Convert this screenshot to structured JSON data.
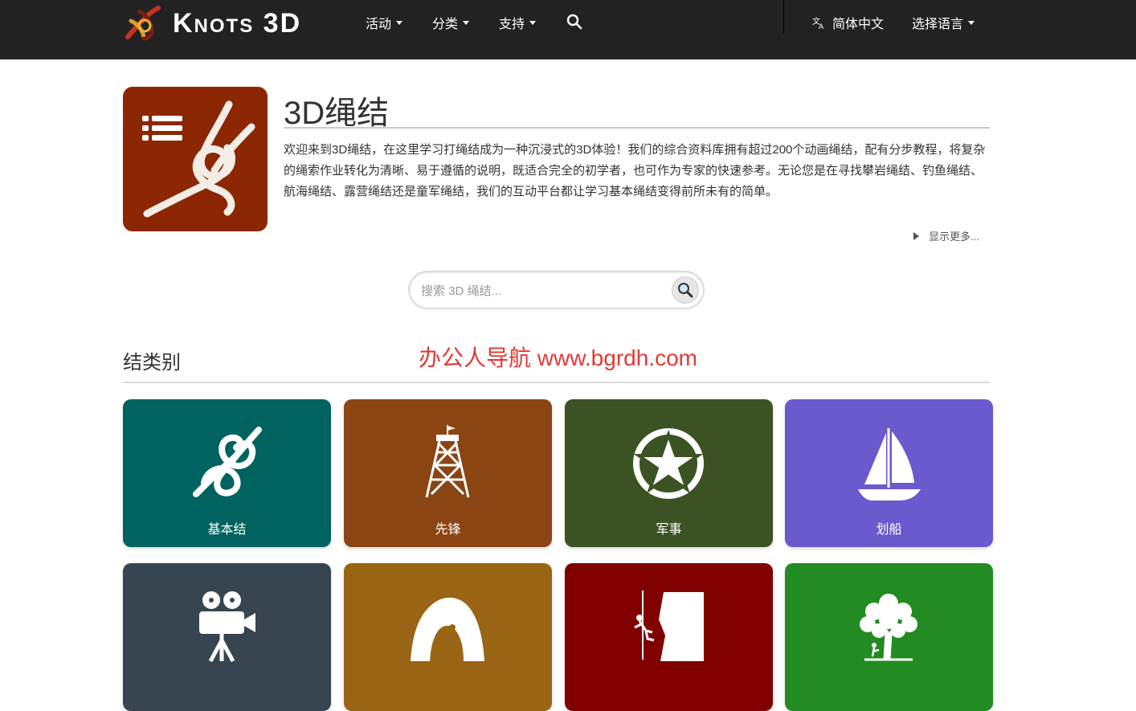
{
  "navbar": {
    "brand": "Knots 3D",
    "menu": [
      {
        "label": "活动"
      },
      {
        "label": "分类"
      },
      {
        "label": "支持"
      }
    ],
    "current_language": "简体中文",
    "language_menu": "选择语言"
  },
  "intro": {
    "title": "3D绳结",
    "description": "欢迎来到3D绳结，在这里学习打绳结成为一种沉浸式的3D体验！我们的综合资料库拥有超过200个动画绳结，配有分步教程，将复杂的绳索作业转化为清晰、易于遵循的说明，既适合完全的初学者，也可作为专家的快速参考。无论您是在寻找攀岩绳结、钓鱼绳结、航海绳结、露营绳结还是童军绳结，我们的互动平台都让学习基本绳结变得前所未有的简单。",
    "show_more": "显示更多..."
  },
  "search": {
    "placeholder": "搜索 3D 绳结..."
  },
  "categories_section": {
    "title": "结类别",
    "watermark": "办公人导航 www.bgrdh.com"
  },
  "categories": [
    {
      "label": "基本结",
      "color": "#00635f",
      "icon": "basic-knot-icon"
    },
    {
      "label": "先锋",
      "color": "#8b4513",
      "icon": "tower-icon"
    },
    {
      "label": "军事",
      "color": "#3b5323",
      "icon": "military-star-icon"
    },
    {
      "label": "划船",
      "color": "#6a5acd",
      "icon": "sailboat-icon"
    },
    {
      "label": "",
      "color": "#36454f",
      "icon": "movie-camera-icon"
    },
    {
      "label": "",
      "color": "#996515",
      "icon": "cave-climber-icon"
    },
    {
      "label": "",
      "color": "#800000",
      "icon": "rappelling-icon"
    },
    {
      "label": "",
      "color": "#228b22",
      "icon": "tree-climber-icon"
    }
  ],
  "colors": {
    "navbar_bg": "#222222",
    "intro_icon_bg": "#8c2704"
  }
}
